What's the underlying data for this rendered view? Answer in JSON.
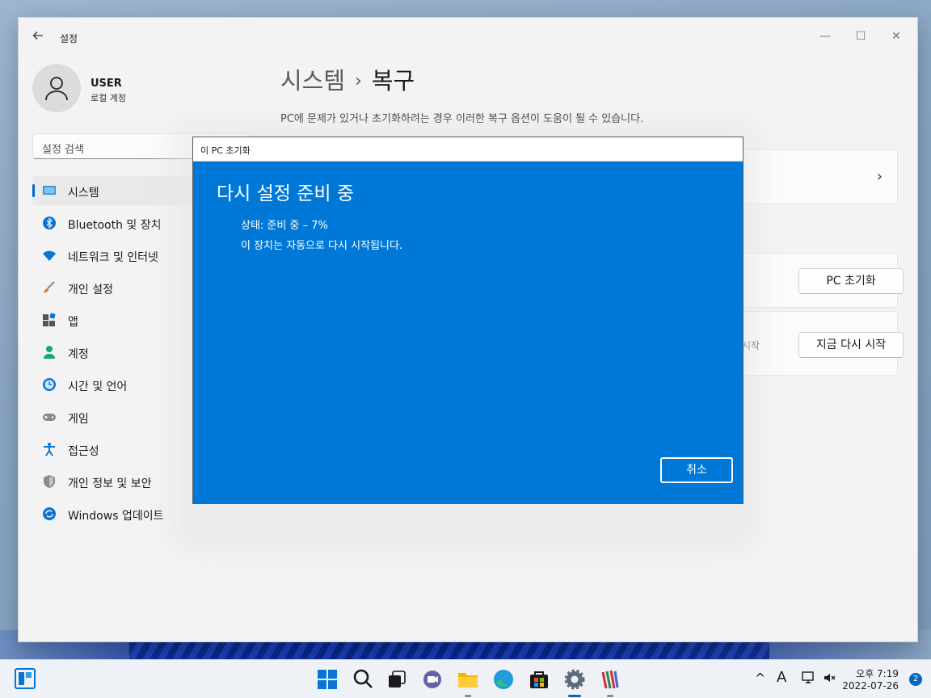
{
  "window": {
    "title": "설정",
    "controls": {
      "minimize": "—",
      "maximize": "☐",
      "close": "✕"
    }
  },
  "user": {
    "name": "USER",
    "account_type": "로컬 계정"
  },
  "search": {
    "placeholder": "설정 검색"
  },
  "nav": {
    "items": [
      {
        "label": "시스템",
        "icon": "system-icon",
        "active": true
      },
      {
        "label": "Bluetooth 및 장치",
        "icon": "bluetooth-icon"
      },
      {
        "label": "네트워크 및 인터넷",
        "icon": "wifi-icon"
      },
      {
        "label": "개인 설정",
        "icon": "brush-icon"
      },
      {
        "label": "앱",
        "icon": "apps-icon"
      },
      {
        "label": "계정",
        "icon": "account-icon"
      },
      {
        "label": "시간 및 언어",
        "icon": "time-language-icon"
      },
      {
        "label": "게임",
        "icon": "gamepad-icon"
      },
      {
        "label": "접근성",
        "icon": "accessibility-icon"
      },
      {
        "label": "개인 정보 및 보안",
        "icon": "shield-icon"
      },
      {
        "label": "Windows 업데이트",
        "icon": "update-icon"
      }
    ]
  },
  "main": {
    "breadcrumb_parent": "시스템",
    "breadcrumb_separator": "›",
    "breadcrumb_current": "복구",
    "description": "PC에 문제가 있거나 초기화하려는 경우 이러한 복구 옵션이 도움이 될 수 있습니다.",
    "reset_button": "PC 초기화",
    "restart_partial_text": "시작",
    "restart_button": "지금 다시 시작"
  },
  "dialog": {
    "title": "이 PC 초기화",
    "heading": "다시 설정 준비 중",
    "status": "상태: 준비 중 – 7%",
    "note": "이 장치는 자동으로 다시 시작됩니다.",
    "cancel": "취소",
    "progress_percent": 7
  },
  "taskbar": {
    "clock_time": "오후 7:19",
    "clock_date": "2022-07-26",
    "notification_count": "2",
    "tray_language": "A",
    "tray_chevron": "^"
  },
  "colors": {
    "dialog_bg": "#0078d7",
    "accent": "#0067c0"
  }
}
